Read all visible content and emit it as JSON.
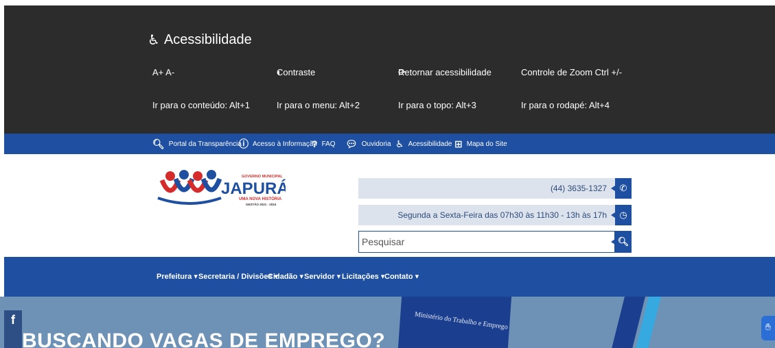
{
  "accessibility": {
    "title": "Acessibilidade",
    "title_icon": "wheelchair-icon",
    "font_size": "A+ A-",
    "contrast": "Contraste",
    "reset": "Retornar acessibilidade",
    "zoom": "Controle de Zoom Ctrl +/-",
    "shortcut_content": "Ir para o conteúdo: Alt+1",
    "shortcut_menu": "Ir para o menu: Alt+2",
    "shortcut_top": "Ir para o topo: Alt+3",
    "shortcut_footer": "Ir para o rodapé: Alt+4"
  },
  "topbar": {
    "items": [
      {
        "label": "Portal da Transparência",
        "icon": "search-icon"
      },
      {
        "label": "Acesso à Informação",
        "icon": "info-icon"
      },
      {
        "label": "FAQ",
        "icon": "question-icon"
      },
      {
        "label": "Ouvidoria",
        "icon": "chat-icon"
      },
      {
        "label": "Acessibilidade",
        "icon": "wheelchair-icon"
      },
      {
        "label": "Mapa do Site",
        "icon": "sitemap-icon"
      }
    ]
  },
  "logo": {
    "top_text": "GOVERNO MUNICIPAL",
    "name": "JAPURÁ",
    "slogan": "UMA NOVA HISTÓRIA",
    "term": "GESTÃO 2021 - 2024"
  },
  "contact": {
    "phone": "(44) 3635-1327",
    "hours": "Segunda a Sexta-Feira das 07h30 às 11h30 - 13h às 17h",
    "search_placeholder": "Pesquisar"
  },
  "nav": {
    "items": [
      "Prefeitura ▾",
      "Secretaria / Divisões ▾",
      "Cidadão ▾",
      "Servidor ▾",
      "Licitações ▾",
      "Contato ▾"
    ]
  },
  "banner": {
    "title": "BUSCANDO VAGAS DE EMPREGO?",
    "book_text": "Ministério do Trabalho e Emprego"
  },
  "colors": {
    "accent_blue": "#1e4fa0",
    "dark_panel": "#2c2c2c",
    "logo_red": "#d62b2b",
    "logo_blue": "#1e4fa0"
  }
}
